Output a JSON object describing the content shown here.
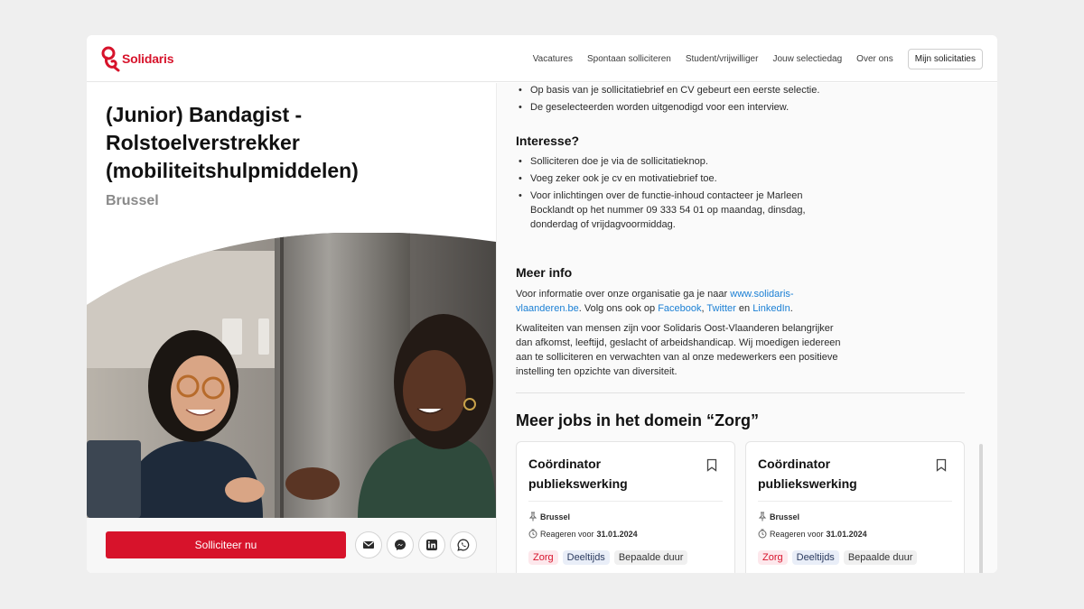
{
  "brand": {
    "name": "Solidaris",
    "accent": "#d7132b"
  },
  "nav": {
    "items": [
      "Vacatures",
      "Spontaan solliciteren",
      "Student/vrijwilliger",
      "Jouw selectiedag",
      "Over ons"
    ],
    "cta": "Mijn solicitaties"
  },
  "job": {
    "title": "(Junior) Bandagist - Rolstoelverstrekker (mobiliteitshulpmiddelen)",
    "location": "Brussel"
  },
  "apply": {
    "label": "Solliciteer nu"
  },
  "share_icons": [
    "mail-icon",
    "messenger-icon",
    "linkedin-icon",
    "whatsapp-icon"
  ],
  "procedure": {
    "items": [
      "Op basis van je sollicitatiebrief en CV gebeurt een eerste selectie.",
      "De geselecteerden worden uitgenodigd voor een interview."
    ]
  },
  "interest": {
    "heading": "Interesse?",
    "items": [
      "Solliciteren doe je via de sollicitatieknop.",
      "Voeg zeker ook je cv en motivatiebrief toe.",
      "Voor inlichtingen over de functie-inhoud contacteer je Marleen Bocklandt op het nummer 09 333 54 01 op maandag, dinsdag, donderdag of vrijdagvoormiddag."
    ]
  },
  "more_info": {
    "heading": "Meer info",
    "p1_a": "Voor informatie over onze organisatie ga je naar ",
    "p1_link": "www.solidaris-vlaanderen.be",
    "p1_b": ". Volg ons ook op ",
    "facebook": "Facebook",
    "comma": ", ",
    "twitter": "Twitter",
    "and": " en ",
    "linkedin": "LinkedIn",
    "dot": ".",
    "p2": "Kwaliteiten van mensen zijn voor Solidaris Oost-Vlaanderen belangrijker dan afkomst, leeftijd, geslacht of arbeidshandicap. Wij moedigen iedereen aan te solliciteren en verwachten van al onze medewerkers een positieve instelling ten opzichte van diversiteit."
  },
  "more_jobs": {
    "heading": "Meer jobs in het domein “Zorg”",
    "cards": [
      {
        "title": "Coördinator publiekswerking",
        "location": "Brussel",
        "deadline_label": "Reageren voor",
        "deadline": "31.01.2024",
        "tags": [
          "Zorg",
          "Deeltijds",
          "Bepaalde duur"
        ]
      },
      {
        "title": "Coördinator publiekswerking",
        "location": "Brussel",
        "deadline_label": "Reageren voor",
        "deadline": "31.01.2024",
        "tags": [
          "Zorg",
          "Deeltijds",
          "Bepaalde duur"
        ]
      }
    ]
  }
}
